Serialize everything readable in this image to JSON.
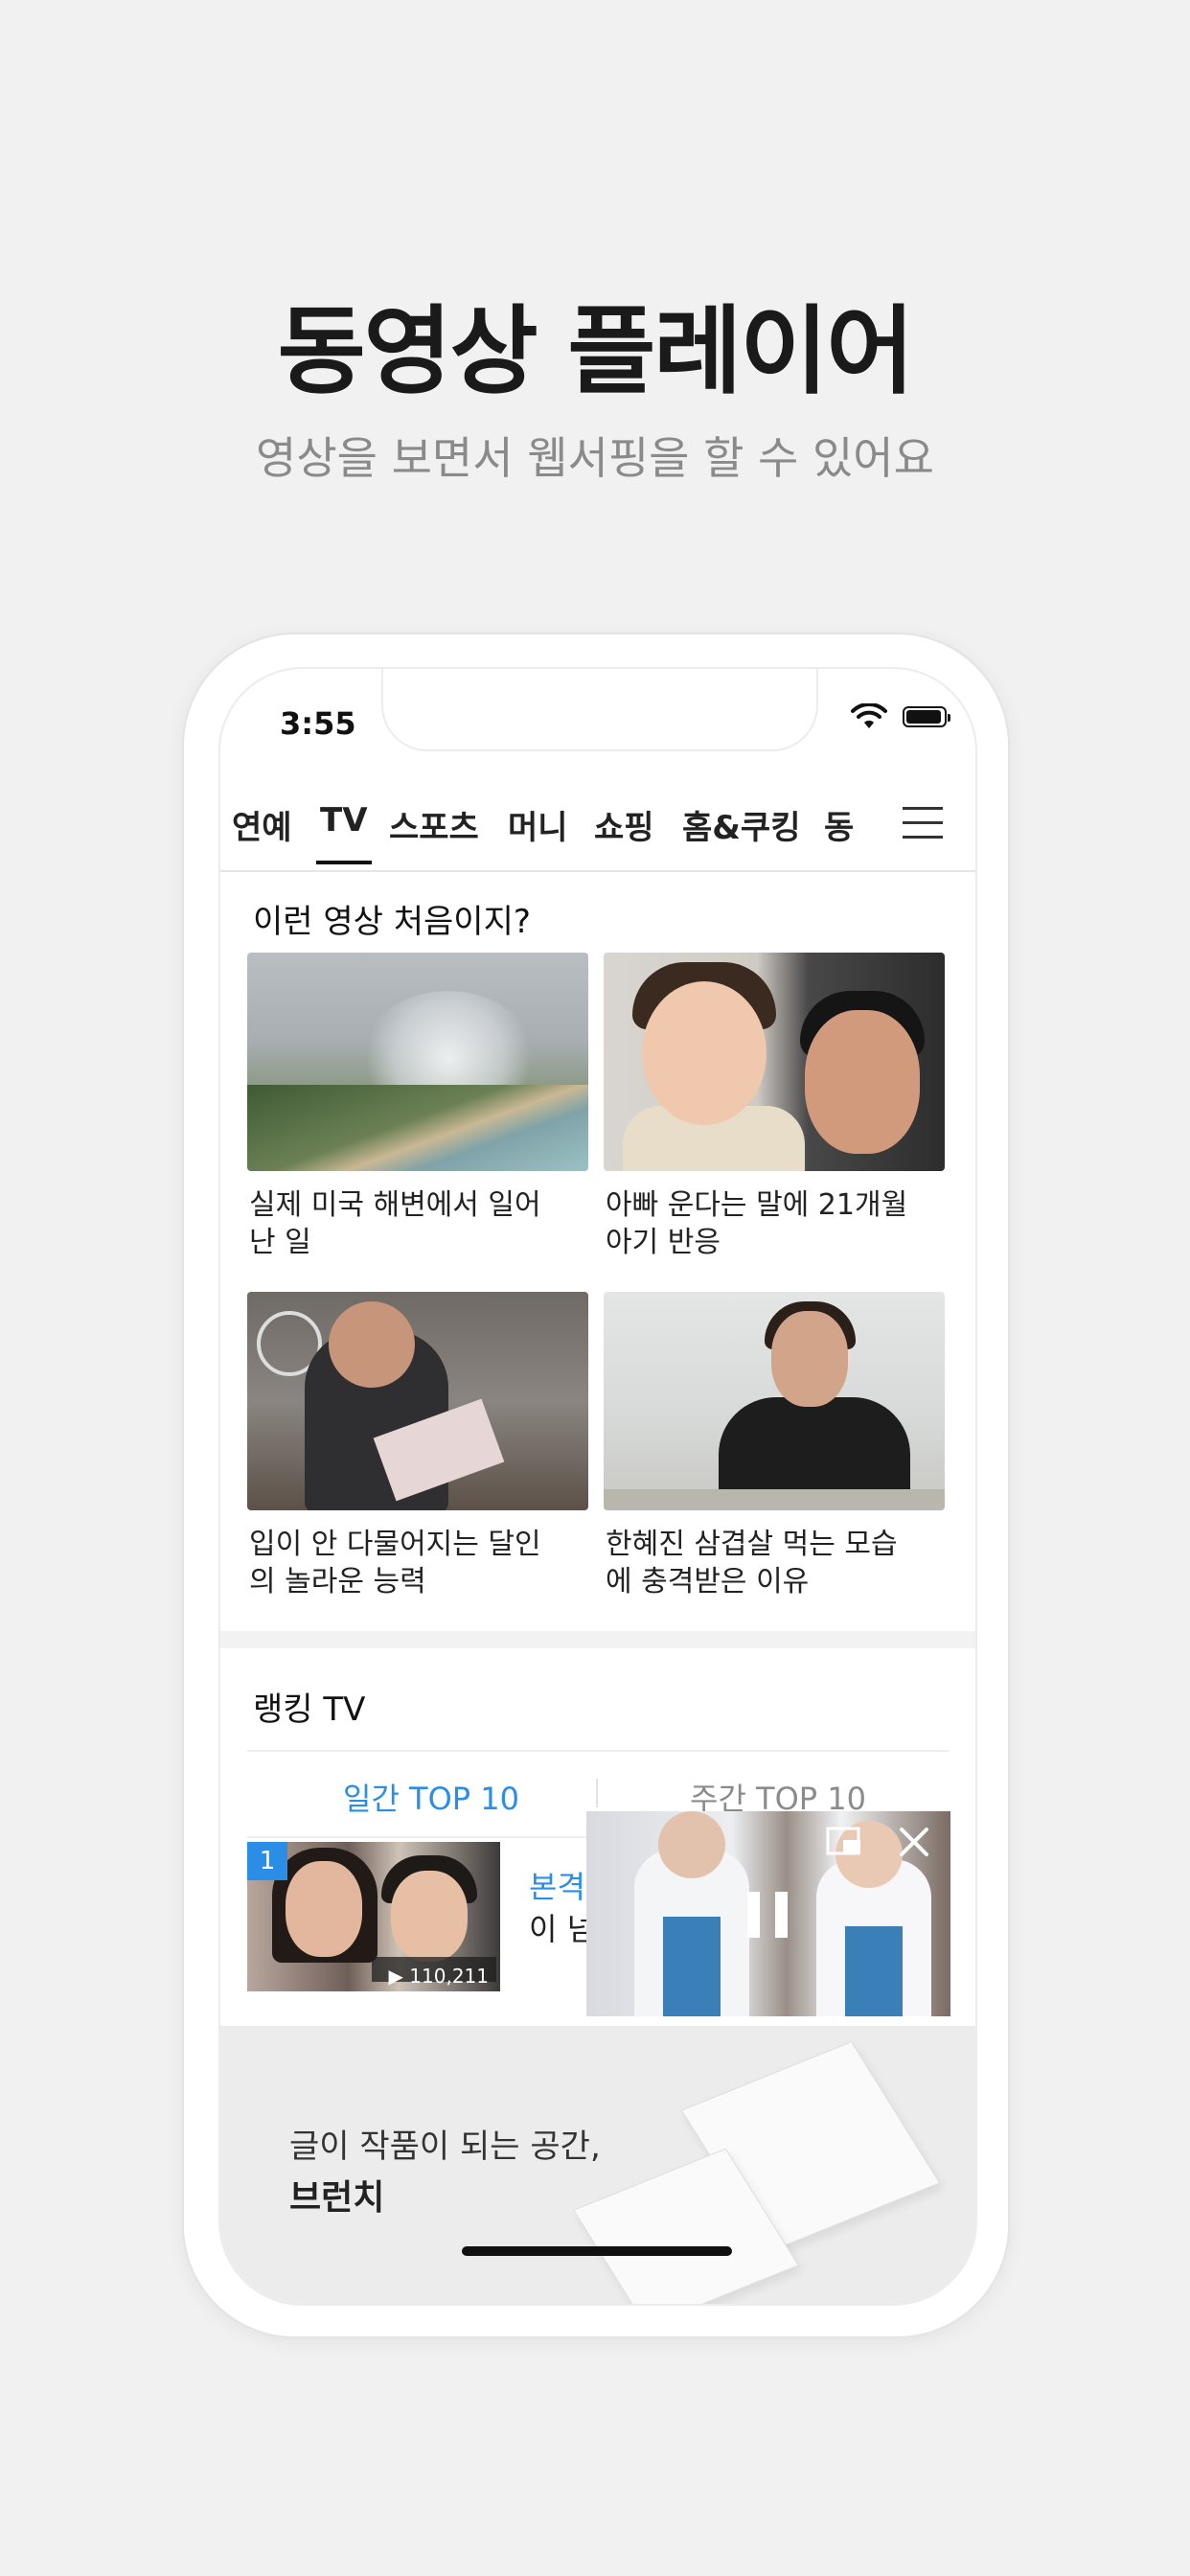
{
  "hero": {
    "title": "동영상 플레이어",
    "subtitle": "영상을 보면서 웹서핑을 할 수 있어요"
  },
  "status_bar": {
    "time": "3:55"
  },
  "nav": {
    "tabs": [
      {
        "label": "연예",
        "active": false
      },
      {
        "label": "TV",
        "active": true
      },
      {
        "label": "스포츠",
        "active": false
      },
      {
        "label": "머니",
        "active": false
      },
      {
        "label": "쇼핑",
        "active": false
      },
      {
        "label": "홈&쿠킹",
        "active": false
      },
      {
        "label": "동",
        "active": false
      }
    ]
  },
  "first_section": {
    "title": "이런 영상 처음이지?",
    "videos": [
      {
        "caption": "실제 미국 해변에서 일어난 일"
      },
      {
        "caption": "아빠 운다는 말에 21개월 아기 반응"
      },
      {
        "caption": "입이 안 다물어지는 달인의 놀라운 능력"
      },
      {
        "caption": "한혜진 삼겹살 먹는 모습에 충격받은 이유"
      }
    ]
  },
  "ranking": {
    "title": "랭킹 TV",
    "tab_daily": "일간 TOP 10",
    "tab_weekly": "주간 TOP 10",
    "items": [
      {
        "rank": "1",
        "views": "▶ 110,211",
        "text_line1": "본격",
        "text_line2": "이 넘"
      }
    ]
  },
  "banner": {
    "line1": "글이 작품이 되는 공간,",
    "line2": "브런치"
  },
  "colors": {
    "accent": "#2a8de6",
    "background": "#f1f1f1"
  }
}
